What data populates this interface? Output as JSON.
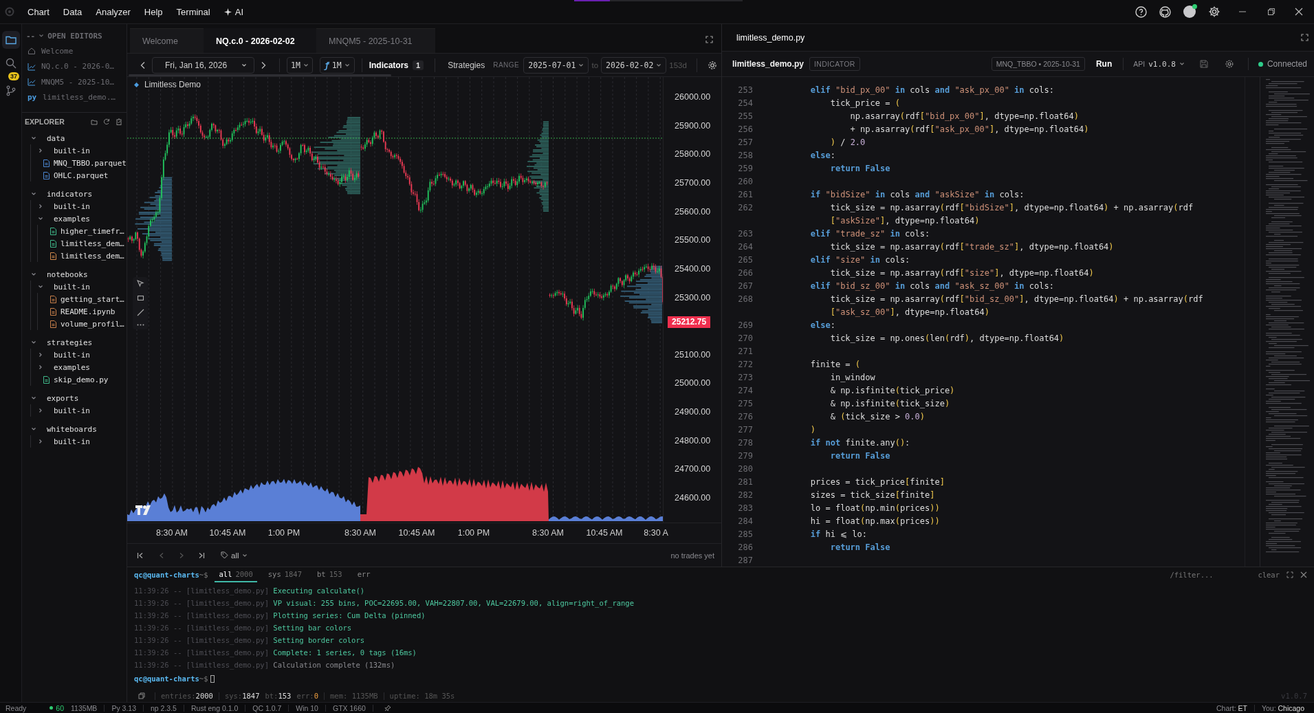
{
  "menu": {
    "items": [
      "Chart",
      "Data",
      "Analyzer",
      "Help",
      "Terminal"
    ],
    "ai": "AI"
  },
  "activity": [
    {
      "kind": "files",
      "selected": true
    },
    {
      "kind": "search",
      "selected": false
    },
    {
      "kind": "git",
      "selected": false,
      "badge": "37"
    }
  ],
  "open_editors": {
    "prefix": "--",
    "title": "OPEN EDITORS",
    "items": [
      {
        "kind": "home",
        "label": "Welcome"
      },
      {
        "kind": "chart",
        "label": "NQ.c.0 - 2026-0…"
      },
      {
        "kind": "chart",
        "label": "MNQM5 - 2025-10…"
      },
      {
        "kind": "py",
        "icon": "py",
        "label": "limitless_demo.…"
      }
    ]
  },
  "explorer": {
    "title": "EXPLORER",
    "tree": [
      {
        "kind": "folder",
        "label": "data",
        "expanded": true,
        "children": [
          {
            "kind": "folder",
            "label": "built-in",
            "expanded": false
          },
          {
            "kind": "data",
            "label": "MNQ_TBBO.parquet"
          },
          {
            "kind": "data",
            "label": "OHLC.parquet"
          }
        ]
      },
      {
        "kind": "folder",
        "label": "indicators",
        "expanded": true,
        "children": [
          {
            "kind": "folder",
            "label": "built-in",
            "expanded": false
          },
          {
            "kind": "folder",
            "label": "examples",
            "expanded": true,
            "children": [
              {
                "kind": "py",
                "label": "higher_timefr…"
              },
              {
                "kind": "py",
                "label": "limitless_dem…"
              },
              {
                "kind": "script",
                "label": "limitless_dem…"
              }
            ]
          }
        ]
      },
      {
        "kind": "folder",
        "label": "notebooks",
        "expanded": true,
        "children": [
          {
            "kind": "folder",
            "label": "built-in",
            "expanded": true,
            "children": [
              {
                "kind": "notebook",
                "label": "getting_start…"
              },
              {
                "kind": "notebook",
                "label": "README.ipynb"
              },
              {
                "kind": "notebook",
                "label": "volume_profil…"
              }
            ]
          }
        ]
      },
      {
        "kind": "folder",
        "label": "strategies",
        "expanded": true,
        "children": [
          {
            "kind": "folder",
            "label": "built-in",
            "expanded": false
          },
          {
            "kind": "folder",
            "label": "examples",
            "expanded": false
          },
          {
            "kind": "py",
            "label": "skip_demo.py"
          }
        ]
      },
      {
        "kind": "folder",
        "label": "exports",
        "expanded": true,
        "children": [
          {
            "kind": "folder",
            "label": "built-in",
            "expanded": false
          }
        ]
      },
      {
        "kind": "folder",
        "label": "whiteboards",
        "expanded": true,
        "children": [
          {
            "kind": "folder",
            "label": "built-in",
            "expanded": false
          }
        ]
      }
    ]
  },
  "chart": {
    "tabs": [
      {
        "label": "Welcome",
        "selected": false
      },
      {
        "label": "NQ.c.0 - 2026-02-02",
        "selected": true
      },
      {
        "label": "MNQM5 - 2025-10-31",
        "selected": false
      }
    ],
    "toolbar": {
      "date": "Fri, Jan 16, 2026",
      "interval": "1M",
      "func_icon": "ƒ",
      "func_interval": "1M",
      "indicators": "Indicators",
      "indicators_count": "1",
      "strategies": "Strategies",
      "range_label": "RANGE",
      "range_from": "2025-07-01",
      "range_to_label": "to",
      "range_to": "2026-02-02",
      "range_days": "153d"
    },
    "legend": "Limitless Demo",
    "price_axis": [
      {
        "kind": "tick",
        "label": "26000.00"
      },
      {
        "kind": "tick",
        "label": "25900.00"
      },
      {
        "kind": "tick",
        "label": "25800.00"
      },
      {
        "kind": "tick",
        "label": "25700.00"
      },
      {
        "kind": "tick",
        "label": "25600.00"
      },
      {
        "kind": "tick",
        "label": "25500.00"
      },
      {
        "kind": "tick",
        "label": "25400.00"
      },
      {
        "kind": "tick",
        "label": "25300.00"
      },
      {
        "kind": "last",
        "label": "25212.75"
      },
      {
        "kind": "tick",
        "label": "25100.00"
      },
      {
        "kind": "tick",
        "label": "25000.00"
      },
      {
        "kind": "tick",
        "label": "24900.00"
      },
      {
        "kind": "tick",
        "label": "24800.00"
      },
      {
        "kind": "tick",
        "label": "24700.00"
      },
      {
        "kind": "tick",
        "label": "24600.00"
      }
    ],
    "time_axis": [
      "8:30 AM",
      "10:45 AM",
      "1:00 PM",
      "8:30 AM",
      "10:45 AM",
      "1:00 PM",
      "8:30 AM",
      "10:45 AM",
      "8:30 A"
    ],
    "footer": {
      "filter": "all",
      "status": "no trades yet"
    }
  },
  "editor": {
    "title": "limitless_demo.py",
    "file": "limitless_demo.py",
    "type_badge": "INDICATOR",
    "source": "MNQ_TBBO • 2025-10-31",
    "run": "Run",
    "api_label": "API",
    "api_version": "v1.0.8",
    "connection": {
      "label": "Connected",
      "connected": true
    },
    "lines": [
      {
        "n": "253",
        "code": "        **elif** \"bid_px_00\" **in** cols **and** \"ask_px_00\" **in** cols:"
      },
      {
        "n": "254",
        "code": "            tick_price = ("
      },
      {
        "n": "255",
        "code": "                np.asarray(rdf[\"bid_px_00\"], dtype=np.float64)"
      },
      {
        "n": "256",
        "code": "                + np.asarray(rdf[\"ask_px_00\"], dtype=np.float64)"
      },
      {
        "n": "257",
        "code": "            ) / 2.0"
      },
      {
        "n": "258",
        "code": "        **else**:"
      },
      {
        "n": "259",
        "code": "            **return False**"
      },
      {
        "n": "260"
      },
      {
        "n": "261",
        "code": "        **if** \"bidSize\" **in** cols **and** \"askSize\" **in** cols:"
      },
      {
        "n": "262",
        "code": "            tick_size = np.asarray(rdf[\"bidSize\"], dtype=np.float64) + np.asarray(rdf",
        "cont": "            [\"askSize\"], dtype=np.float64)"
      },
      {
        "n": "263",
        "code": "        **elif** \"trade_sz\" **in** cols:"
      },
      {
        "n": "264",
        "code": "            tick_size = np.asarray(rdf[\"trade_sz\"], dtype=np.float64)"
      },
      {
        "n": "265",
        "code": "        **elif** \"size\" **in** cols:"
      },
      {
        "n": "266",
        "code": "            tick_size = np.asarray(rdf[\"size\"], dtype=np.float64)"
      },
      {
        "n": "267",
        "code": "        **elif** \"bid_sz_00\" **in** cols **and** \"ask_sz_00\" **in** cols:"
      },
      {
        "n": "268",
        "code": "            tick_size = np.asarray(rdf[\"bid_sz_00\"], dtype=np.float64) + np.asarray(rdf",
        "cont": "            [\"ask_sz_00\"], dtype=np.float64)"
      },
      {
        "n": "269",
        "code": "        **else**:"
      },
      {
        "n": "270",
        "code": "            tick_size = np.ones(len(rdf), dtype=np.float64)"
      },
      {
        "n": "271"
      },
      {
        "n": "272",
        "code": "        finite = ("
      },
      {
        "n": "273",
        "code": "            in_window"
      },
      {
        "n": "274",
        "code": "            & np.isfinite(tick_price)"
      },
      {
        "n": "275",
        "code": "            & np.isfinite(tick_size)"
      },
      {
        "n": "276",
        "code": "            & (tick_size > 0.0)"
      },
      {
        "n": "277",
        "code": "        )"
      },
      {
        "n": "278",
        "code": "        **if not** finite.any():"
      },
      {
        "n": "279",
        "code": "            **return False**"
      },
      {
        "n": "280"
      },
      {
        "n": "281",
        "code": "        prices = tick_price[finite]"
      },
      {
        "n": "282",
        "code": "        sizes = tick_size[finite]"
      },
      {
        "n": "283",
        "code": "        lo = float(np.min(prices))"
      },
      {
        "n": "284",
        "code": "        hi = float(np.max(prices))"
      },
      {
        "n": "285",
        "code": "        **if** hi ⩽ lo:"
      },
      {
        "n": "286",
        "code": "            **return False**"
      },
      {
        "n": "287"
      }
    ]
  },
  "terminal": {
    "user": "qc@quant-charts",
    "path": "~$",
    "tabs": [
      {
        "label": "all",
        "count": "2000",
        "selected": true
      },
      {
        "label": "sys",
        "count": "1847",
        "selected": false
      },
      {
        "label": "bt",
        "count": "153",
        "selected": false
      },
      {
        "label": "err",
        "selected": false
      }
    ],
    "filter_placeholder": "/filter...",
    "clear": "clear",
    "prompt": {
      "user": "qc@quant-charts",
      "path": "~$"
    },
    "logs": [
      {
        "time": "11:39:26",
        "source": "-- [limitless_demo.py]",
        "message": "Executing calculate()",
        "kind": "success"
      },
      {
        "time": "11:39:26",
        "source": "-- [limitless_demo.py]",
        "message": "VP visual: 255 bins, POC=22695.00, VAH=22807.00, VAL=22679.00, align=right_of_range",
        "kind": "success"
      },
      {
        "time": "11:39:26",
        "source": "-- [limitless_demo.py]",
        "message": "Plotting series: Cum Delta (pinned)",
        "kind": "success"
      },
      {
        "time": "11:39:26",
        "source": "-- [limitless_demo.py]",
        "message": "Setting bar colors",
        "kind": "success"
      },
      {
        "time": "11:39:26",
        "source": "-- [limitless_demo.py]",
        "message": "Setting border colors",
        "kind": "success"
      },
      {
        "time": "11:39:26",
        "source": "-- [limitless_demo.py]",
        "message": "Complete: 1 series, 0 tags (16ms)",
        "kind": "success"
      },
      {
        "time": "11:39:26",
        "source": "-- [limitless_demo.py]",
        "message": "Calculation complete (132ms)",
        "kind": "info"
      }
    ],
    "stats": [
      {
        "label": "entries:",
        "value": "2000",
        "kind": "normal"
      },
      {
        "label": "sys:",
        "value": "1847",
        "kind": "normal"
      },
      {
        "label": "bt:",
        "value": "153",
        "kind": "normal"
      },
      {
        "label": "err:",
        "value": "0",
        "kind": "error"
      }
    ],
    "mem": "mem: 1135MB",
    "uptime": "uptime: 18m 35s",
    "version": "v1.0.7"
  },
  "status_bar": {
    "ready": "Ready",
    "fps": "60",
    "mem": "1135MB",
    "items": [
      "Py 3.13",
      "np 2.3.5",
      "Rust eng 0.1.0",
      "QC 1.0.7",
      "Win 10",
      "GTX 1660"
    ],
    "chart_tz_label": "Chart:",
    "chart_tz": "ET",
    "user_label": "You:",
    "user_location": "Chicago"
  }
}
